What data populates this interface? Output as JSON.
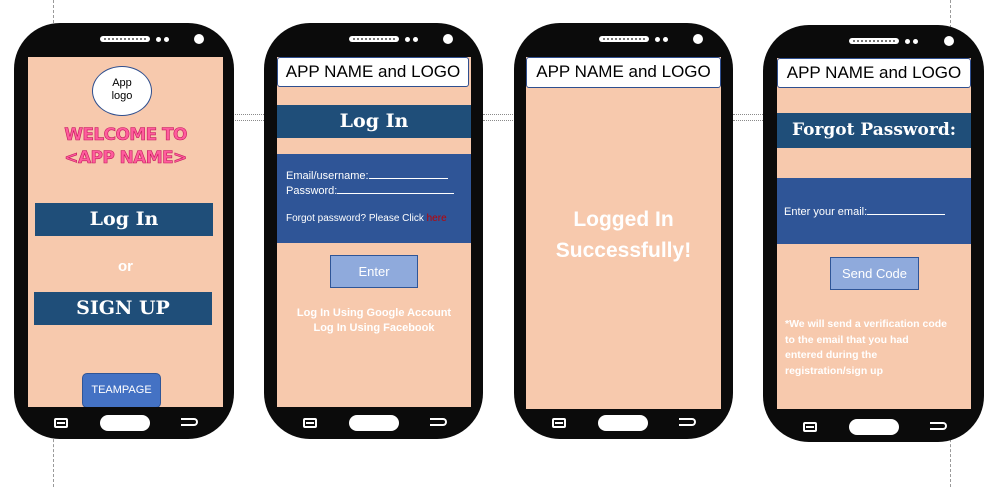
{
  "screen1": {
    "logo_text_1": "App",
    "logo_text_2": "logo",
    "welcome_line_1": "WELCOME TO",
    "welcome_line_2": "<APP NAME>",
    "login_label": "Log In",
    "or_label": "or",
    "signup_label": "SIGN UP",
    "teampage_label": "TEAMPAGE"
  },
  "screen2": {
    "header": "APP NAME and LOGO",
    "title": "Log In",
    "email_label": "Email/username:",
    "password_label": "Password:",
    "forgot_text": "Forgot password? Please Click ",
    "forgot_link": "here",
    "enter_label": "Enter",
    "google_label": "Log In Using Google Account",
    "facebook_label": "Log In Using Facebook"
  },
  "screen3": {
    "header": "APP NAME and LOGO",
    "message_line_1": "Logged In",
    "message_line_2": "Successfully!"
  },
  "screen4": {
    "header": "APP NAME and LOGO",
    "title": "Forgot Password:",
    "email_label": "Enter your email:",
    "send_label": "Send Code",
    "note_line_1": "*We will send a verification code",
    "note_line_2": "to the email that you had",
    "note_line_3": "entered during the",
    "note_line_4": "registration/sign up"
  },
  "colors": {
    "screen_bg": "#f7c9ad",
    "dark_blue": "#1f4e79",
    "panel_blue": "#2f5597",
    "light_blue_button": "#8faadc",
    "welcome_pink": "#ff5c9d",
    "link_red": "#c00000"
  },
  "icons": [
    "menu-icon",
    "home-button",
    "back-icon",
    "speaker-icon",
    "camera-icon"
  ]
}
